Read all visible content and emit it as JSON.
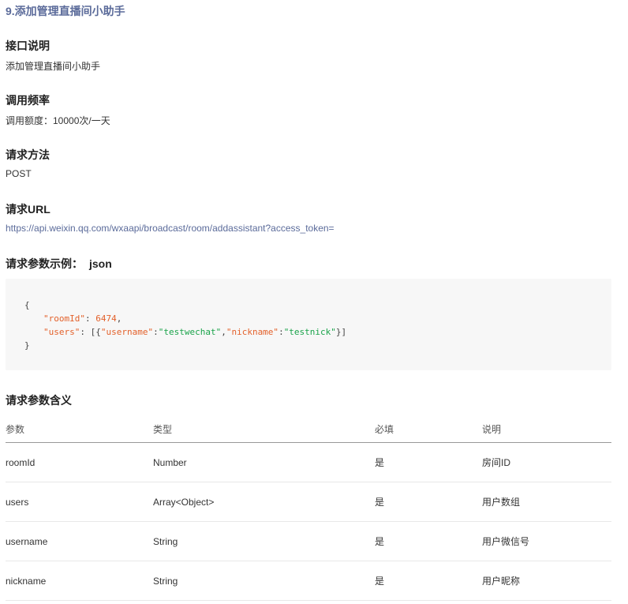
{
  "title": "9.添加管理直播间小助手",
  "sections": {
    "desc_heading": "接口说明",
    "desc_text": "添加管理直播间小助手",
    "rate_heading": "调用频率",
    "rate_text": "调用额度：10000次/一天",
    "method_heading": "请求方法",
    "method_text": "POST",
    "url_heading": "请求URL",
    "url_text": "https://api.weixin.qq.com/wxaapi/broadcast/room/addassistant?access_token=",
    "example_heading": "请求参数示例：",
    "example_format": "json",
    "params_heading": "请求参数含义"
  },
  "code": {
    "open": "{",
    "k1": "\"roomId\"",
    "colon": ": ",
    "v1": "6474",
    "comma": ",",
    "k2": "\"users\"",
    "arr_open": "[{",
    "k3": "\"username\"",
    "c": ":",
    "v3": "\"testwechat\"",
    "k4": "\"nickname\"",
    "v4": "\"testnick\"",
    "arr_close": "}]",
    "close": "}"
  },
  "table": {
    "headers": [
      "参数",
      "类型",
      "必填",
      "说明"
    ],
    "rows": [
      [
        "roomId",
        "Number",
        "是",
        "房间ID"
      ],
      [
        "users",
        "Array<Object>",
        "是",
        "用户数组"
      ],
      [
        "username",
        "String",
        "是",
        "用户微信号"
      ],
      [
        "nickname",
        "String",
        "是",
        "用户昵称"
      ]
    ]
  }
}
